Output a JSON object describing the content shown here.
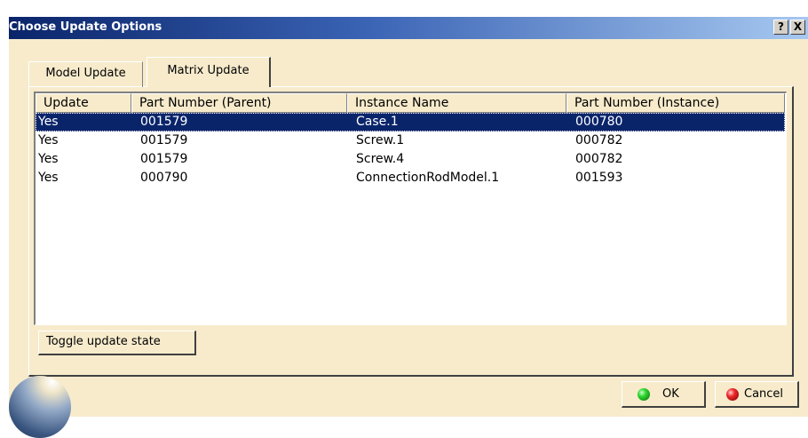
{
  "window": {
    "title": "Choose Update Options"
  },
  "titlebar_buttons": {
    "help": "?",
    "close": "X"
  },
  "tabs": [
    {
      "label": "Model Update",
      "active": false
    },
    {
      "label": "Matrix Update",
      "active": true
    }
  ],
  "table": {
    "columns": [
      "Update",
      "Part Number (Parent)",
      "Instance Name",
      "Part Number (Instance)"
    ],
    "rows": [
      {
        "update": "Yes",
        "parent": "001579",
        "instance": "Case.1",
        "part": "000780",
        "selected": true
      },
      {
        "update": "Yes",
        "parent": "001579",
        "instance": "Screw.1",
        "part": "000782",
        "selected": false
      },
      {
        "update": "Yes",
        "parent": "001579",
        "instance": "Screw.4",
        "part": "000782",
        "selected": false
      },
      {
        "update": "Yes",
        "parent": "000790",
        "instance": "ConnectionRodModel.1",
        "part": "001593",
        "selected": false
      }
    ]
  },
  "buttons": {
    "toggle": "Toggle update state",
    "ok": "OK",
    "cancel": "Cancel"
  },
  "icons": {
    "ok": "green-dot-icon",
    "cancel": "red-dot-icon"
  },
  "colors": {
    "selection": "#0a246a",
    "dialog_bg": "#f7ebcc",
    "titlebar": "#0a246a"
  }
}
